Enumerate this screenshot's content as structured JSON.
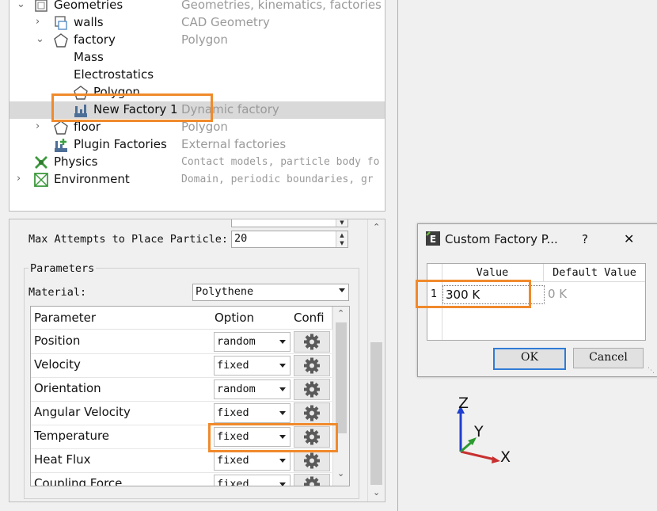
{
  "tree": {
    "items": [
      {
        "label": "Geometries",
        "desc": "Geometries, kinematics, factories"
      },
      {
        "label": "walls",
        "desc": "CAD Geometry"
      },
      {
        "label": "factory",
        "desc": "Polygon"
      },
      {
        "label": "Mass",
        "desc": ""
      },
      {
        "label": "Electrostatics",
        "desc": ""
      },
      {
        "label": "Polygon",
        "desc": ""
      },
      {
        "label": "New Factory 1",
        "desc": "Dynamic factory"
      },
      {
        "label": "floor",
        "desc": "Polygon"
      },
      {
        "label": "Plugin Factories",
        "desc": "External factories"
      },
      {
        "label": "Physics",
        "desc": "Contact models, particle body fo"
      },
      {
        "label": "Environment",
        "desc": "Domain, periodic boundaries, gr"
      }
    ]
  },
  "settings": {
    "max_attempts_label": "Max Attempts to Place Particle:",
    "max_attempts_value": "20",
    "parameters_group": "Parameters",
    "material_label": "Material:",
    "material_value": "Polythene"
  },
  "param_table": {
    "headers": [
      "Parameter",
      "Option",
      "Confi"
    ],
    "rows": [
      {
        "name": "Position",
        "option": "random"
      },
      {
        "name": "Velocity",
        "option": "fixed"
      },
      {
        "name": "Orientation",
        "option": "random"
      },
      {
        "name": "Angular Velocity",
        "option": "fixed"
      },
      {
        "name": "Temperature",
        "option": "fixed"
      },
      {
        "name": "Heat Flux",
        "option": "fixed"
      },
      {
        "name": "Coupling Force",
        "option": "fixed"
      }
    ]
  },
  "dialog": {
    "title": "Custom Factory P...",
    "help": "?",
    "close": "✕",
    "col_value": "Value",
    "col_default": "Default Value",
    "row_index": "1",
    "value": "300 K",
    "default_value": "0 K",
    "ok": "OK",
    "cancel": "Cancel"
  },
  "axes": {
    "z": "Z",
    "y": "Y",
    "x": "X"
  },
  "colors": {
    "highlight": "#f08a2c",
    "accent": "#2f7bd6"
  }
}
